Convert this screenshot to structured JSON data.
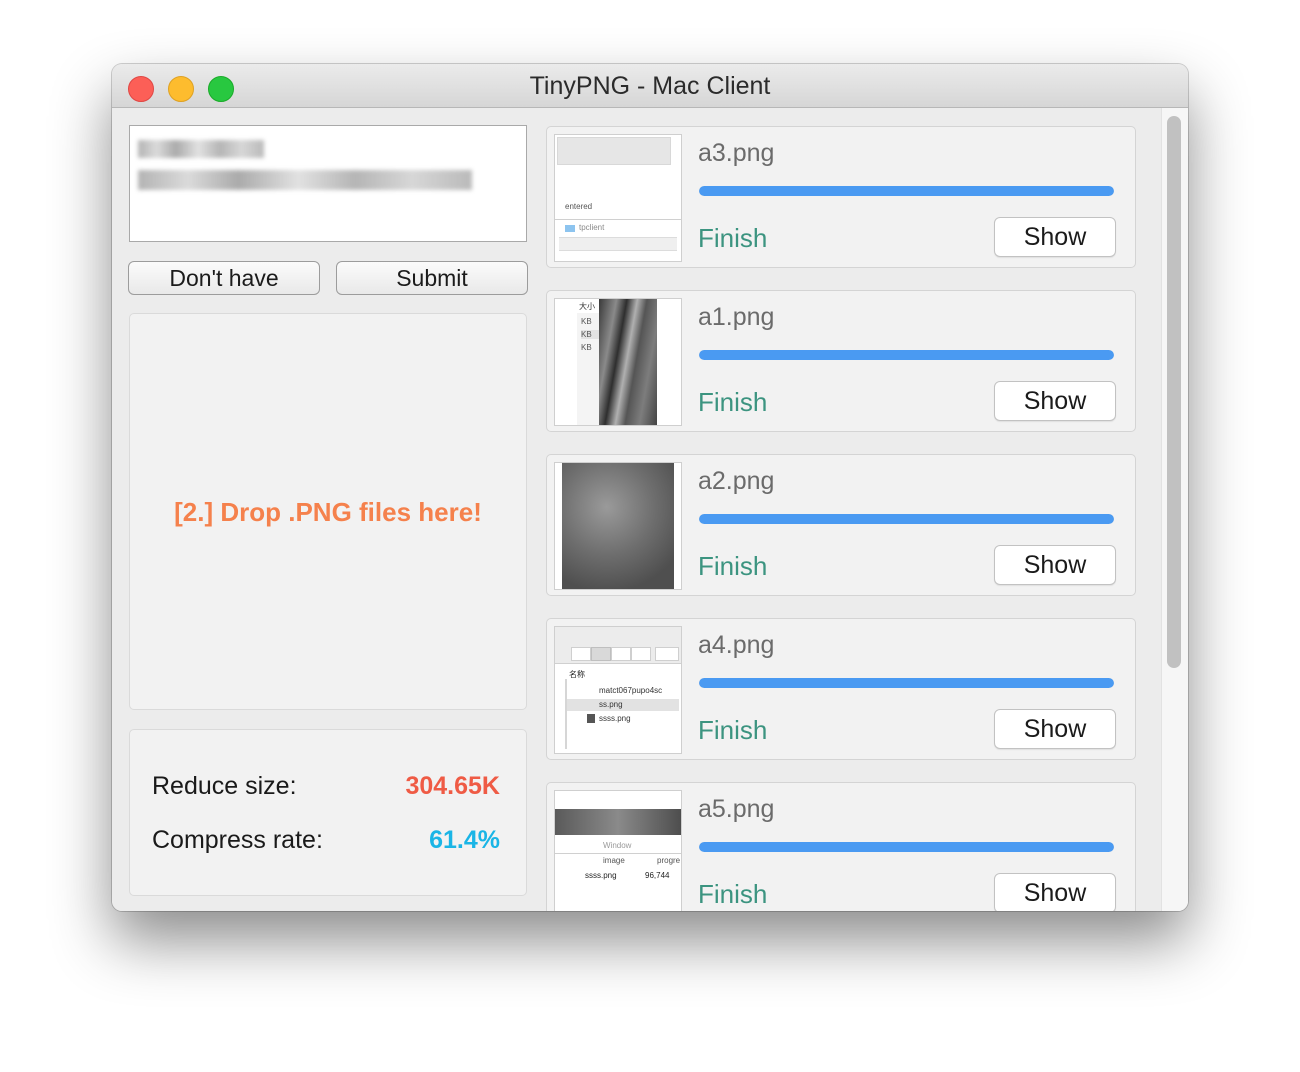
{
  "window": {
    "title": "TinyPNG - Mac Client"
  },
  "left_panel": {
    "buttons": {
      "dont_have": "Don't have",
      "submit": "Submit"
    },
    "drop_zone_text": "[2.] Drop .PNG files here!",
    "stats": {
      "reduce_label": "Reduce size:",
      "reduce_value": "304.65K",
      "compress_label": "Compress rate:",
      "compress_value": "61.4%"
    }
  },
  "files": [
    {
      "name": "a3.png",
      "progress": 1.0,
      "status": "Finish",
      "button": "Show",
      "thumb_text": [
        "entered",
        "tpclient"
      ]
    },
    {
      "name": "a1.png",
      "progress": 1.0,
      "status": "Finish",
      "button": "Show",
      "thumb_text": [
        "大小",
        "KB",
        "KB",
        "KB"
      ]
    },
    {
      "name": "a2.png",
      "progress": 1.0,
      "status": "Finish",
      "button": "Show",
      "thumb_text": []
    },
    {
      "name": "a4.png",
      "progress": 1.0,
      "status": "Finish",
      "button": "Show",
      "thumb_text": [
        "名称",
        "matct067pupo4sc",
        "ss.png",
        "ssss.png"
      ]
    },
    {
      "name": "a5.png",
      "progress": 1.0,
      "status": "Finish",
      "button": "Show",
      "thumb_text": [
        "Window",
        "image",
        "progre",
        "ssss.png",
        "96,744"
      ]
    }
  ],
  "colors": {
    "drop_text": "#f5814c",
    "reduce_value": "#ef5b45",
    "compress_value": "#1ab5e6",
    "progress": "#4a9af2",
    "status": "#3c9480"
  }
}
